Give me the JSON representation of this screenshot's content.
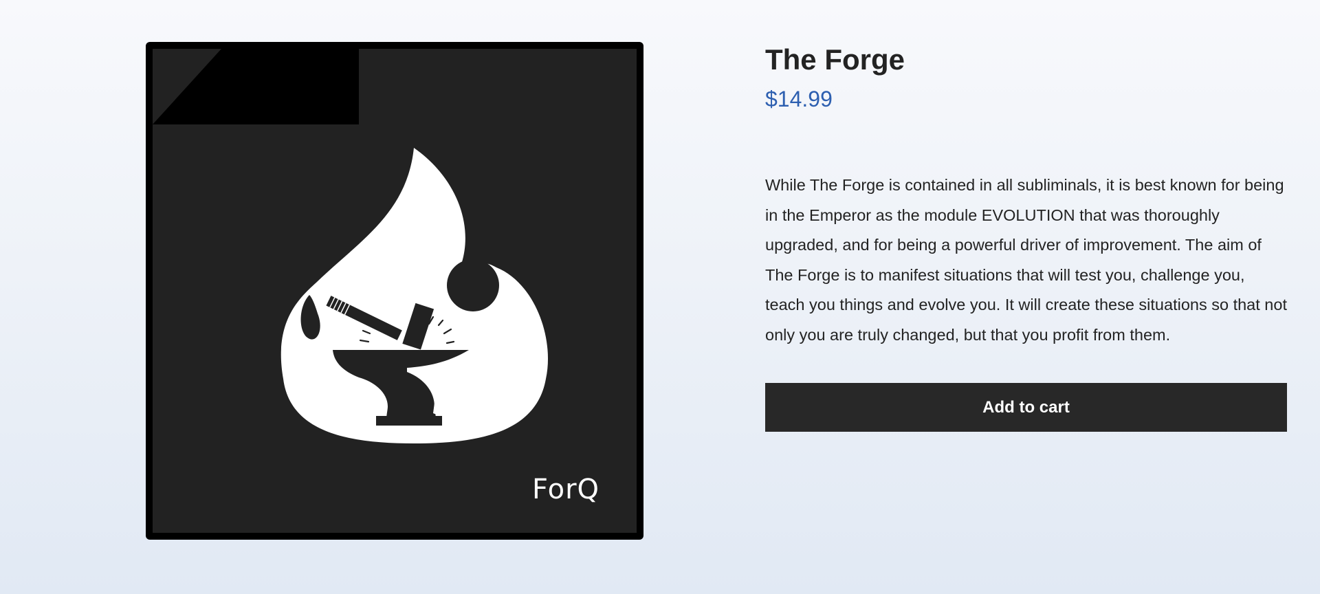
{
  "product": {
    "title": "The Forge",
    "price": "$14.99",
    "description": "While The Forge is contained in all subliminals, it is best known for being in the Emperor as the module EVOLUTION that was thoroughly upgraded, and for being a powerful driver of improvement. The aim of The Forge is to manifest situations that will test you, challenge you, teach you things and evolve you. It will create these situations so that not only you are truly changed, but that you profit from them.",
    "add_to_cart_label": "Add to cart"
  },
  "image": {
    "brand_text": "ForQ",
    "icon": "flame-anvil-hammer-icon"
  },
  "colors": {
    "price": "#2d5fb0",
    "button_bg": "#282828",
    "image_bg": "#222222"
  }
}
